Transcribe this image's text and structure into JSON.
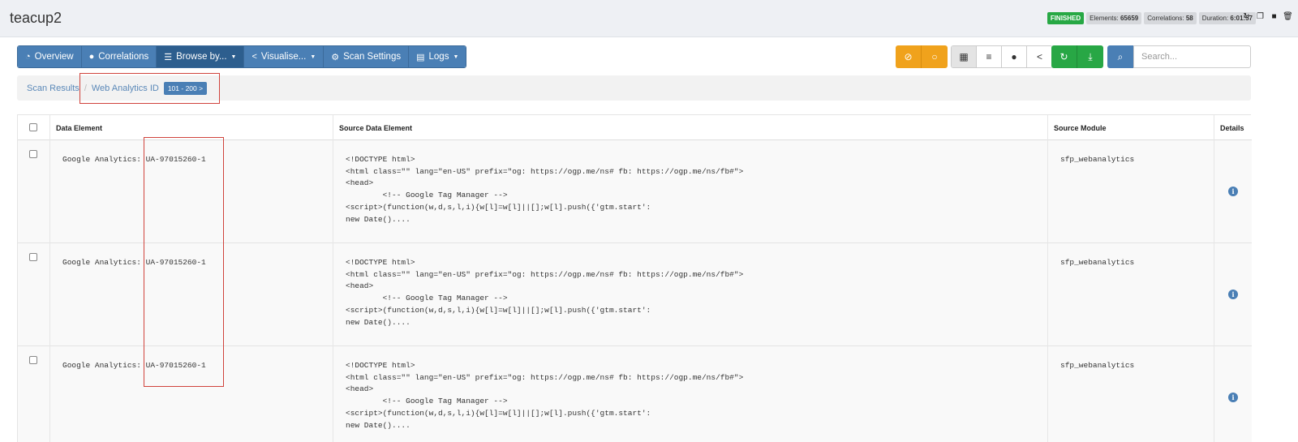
{
  "header": {
    "title": "teacup2",
    "status": "FINISHED",
    "elements_label": "Elements:",
    "elements_value": "65659",
    "correlations_label": "Correlations:",
    "correlations_value": "58",
    "duration_label": "Duration:",
    "duration_value": "6:01:57"
  },
  "nav": {
    "items": [
      {
        "label": "Overview",
        "icon": "dashboard-icon"
      },
      {
        "label": "Correlations",
        "icon": "exclamation-icon"
      },
      {
        "label": "Browse by...",
        "icon": "list-icon"
      },
      {
        "label": "Visualise...",
        "icon": "share-icon"
      },
      {
        "label": "Scan Settings",
        "icon": "gear-icon"
      },
      {
        "label": "Logs",
        "icon": "book-icon"
      }
    ]
  },
  "search": {
    "placeholder": "Search..."
  },
  "breadcrumb": {
    "root": "Scan Results",
    "separator": "/",
    "current": "Web Analytics ID",
    "page_badge": "101 - 200 >"
  },
  "table": {
    "headers": [
      "Data Element",
      "Source Data Element",
      "Source Module",
      "Details"
    ],
    "rows": [
      {
        "data_element": "Google Analytics: UA-97015260-1",
        "source": "<!DOCTYPE html>\n<html class=\"\" lang=\"en-US\" prefix=\"og: https://ogp.me/ns# fb: https://ogp.me/ns/fb#\">\n<head>\n        <!-- Google Tag Manager -->\n<script>(function(w,d,s,l,i){w[l]=w[l]||[];w[l].push({'gtm.start':\nnew Date()....",
        "module": "sfp_webanalytics"
      },
      {
        "data_element": "Google Analytics: UA-97015260-1",
        "source": "<!DOCTYPE html>\n<html class=\"\" lang=\"en-US\" prefix=\"og: https://ogp.me/ns# fb: https://ogp.me/ns/fb#\">\n<head>\n        <!-- Google Tag Manager -->\n<script>(function(w,d,s,l,i){w[l]=w[l]||[];w[l].push({'gtm.start':\nnew Date()....",
        "module": "sfp_webanalytics"
      },
      {
        "data_element": "Google Analytics: UA-97015260-1",
        "source": "<!DOCTYPE html>\n<html class=\"\" lang=\"en-US\" prefix=\"og: https://ogp.me/ns# fb: https://ogp.me/ns/fb#\">\n<head>\n        <!-- Google Tag Manager -->\n<script>(function(w,d,s,l,i){w[l]=w[l]||[];w[l].push({'gtm.start':\nnew Date()....",
        "module": "sfp_webanalytics"
      }
    ]
  },
  "colors": {
    "primary": "#4a7fb5",
    "success": "#28a745",
    "warning": "#f0a21c",
    "highlight": "#d0433c"
  }
}
